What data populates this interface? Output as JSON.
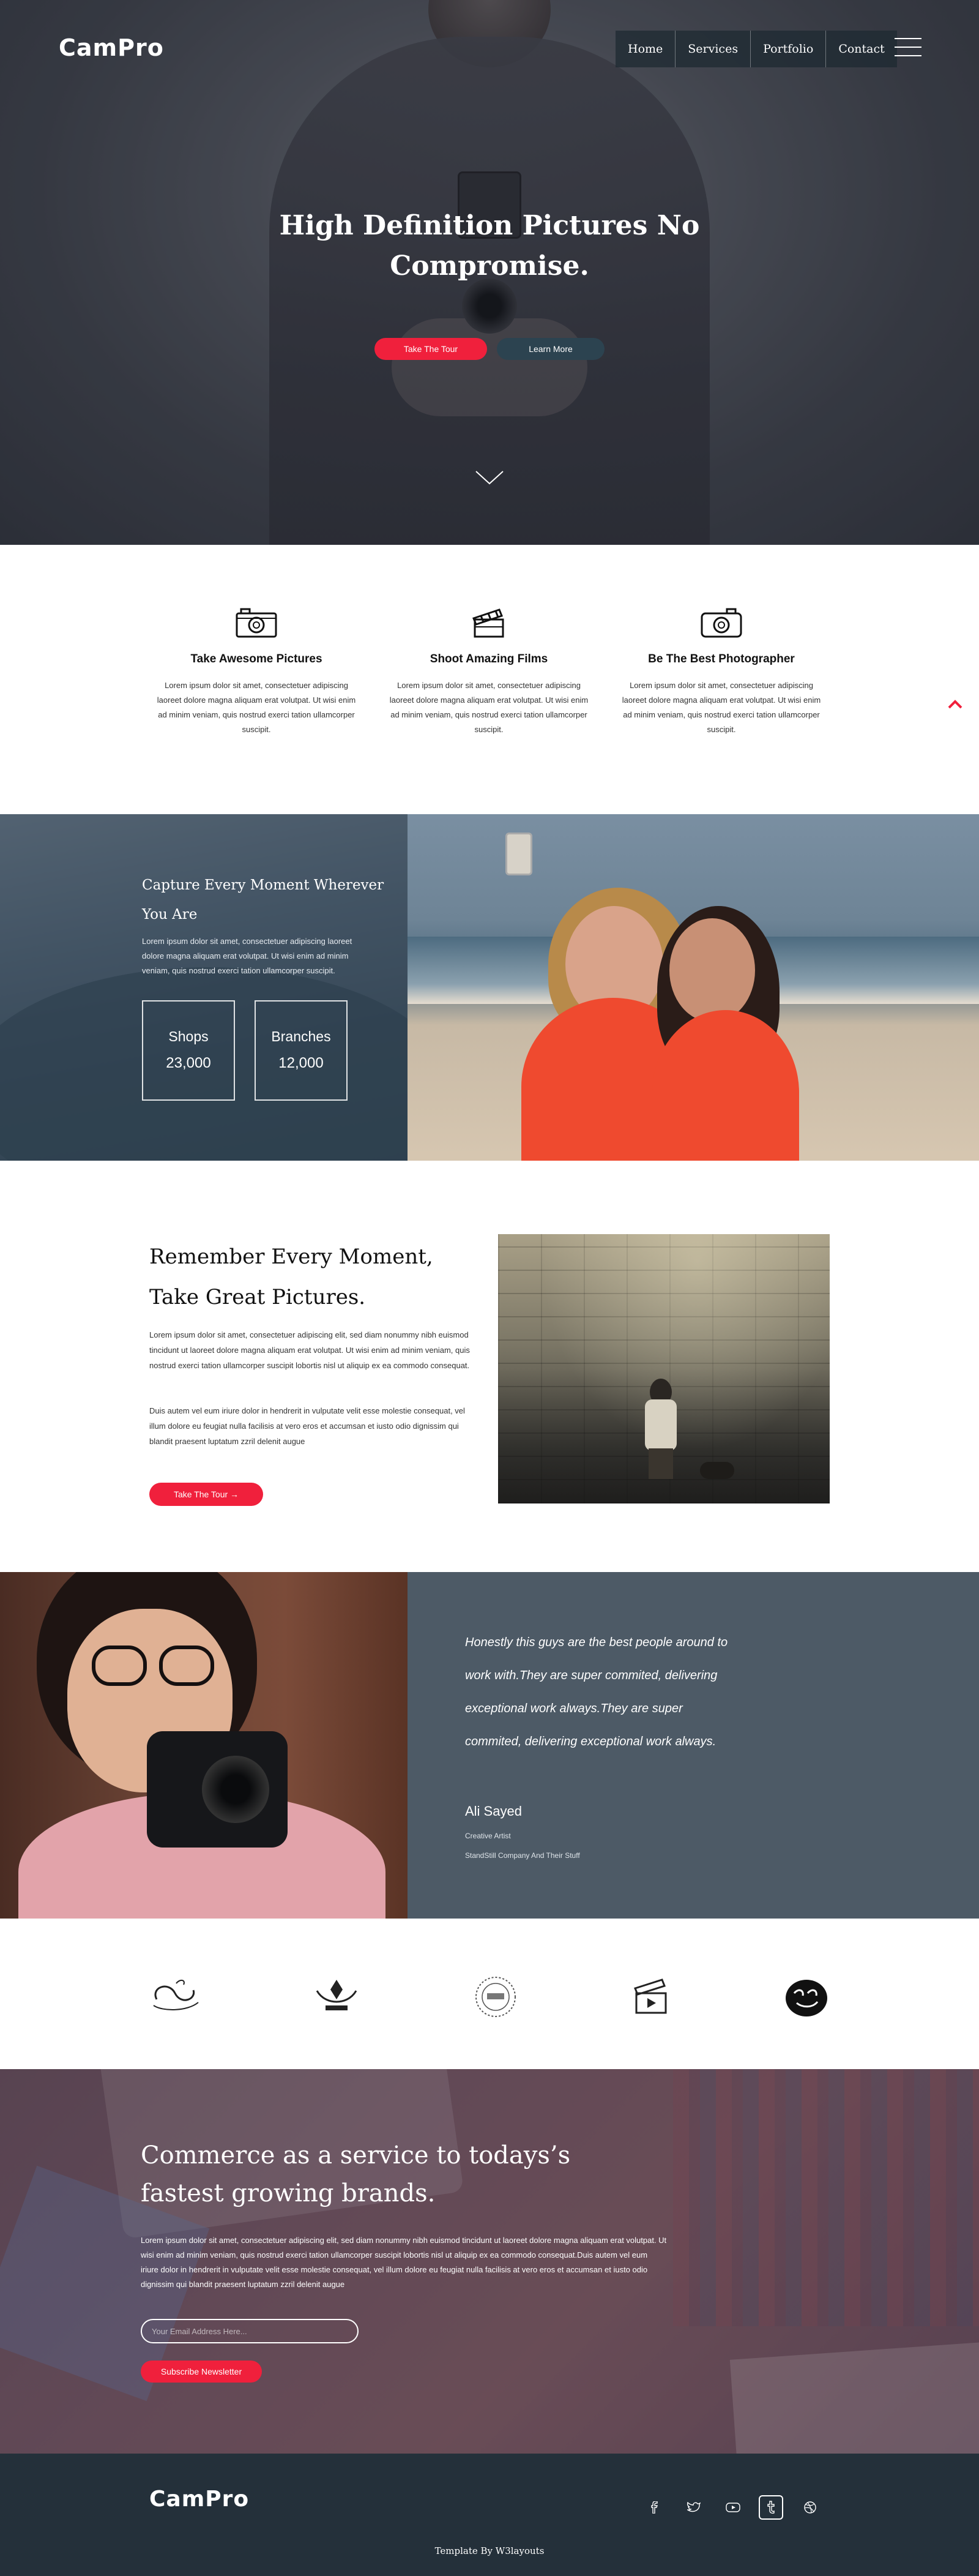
{
  "header": {
    "logo": "CamPro",
    "nav": [
      "Home",
      "Services",
      "Portfolio",
      "Contact"
    ]
  },
  "hero": {
    "title": "High Definition Pictures No Compromise.",
    "primary_button": "Take The Tour",
    "secondary_button": "Learn More"
  },
  "features": [
    {
      "icon": "camera-icon",
      "title": "Take Awesome Pictures",
      "text": "Lorem ipsum dolor sit amet, consectetuer adipiscing laoreet dolore magna aliquam erat volutpat. Ut wisi enim ad minim veniam, quis nostrud exerci tation ullamcorper suscipit."
    },
    {
      "icon": "clapperboard-icon",
      "title": "Shoot Amazing Films",
      "text": "Lorem ipsum dolor sit amet, consectetuer adipiscing laoreet dolore magna aliquam erat volutpat. Ut wisi enim ad minim veniam, quis nostrud exerci tation ullamcorper suscipit."
    },
    {
      "icon": "camera-icon",
      "title": "Be The Best Photographer",
      "text": "Lorem ipsum dolor sit amet, consectetuer adipiscing laoreet dolore magna aliquam erat volutpat. Ut wisi enim ad minim veniam, quis nostrud exerci tation ullamcorper suscipit."
    }
  ],
  "capture": {
    "title": "Capture Every Moment Wherever You Are",
    "text": "Lorem ipsum dolor sit amet, consectetuer adipiscing laoreet dolore magna aliquam erat volutpat. Ut wisi enim ad minim veniam, quis nostrud exerci tation ullamcorper suscipit.",
    "stats": [
      {
        "label": "Shops",
        "value": "23,000"
      },
      {
        "label": "Branches",
        "value": "12,000"
      }
    ]
  },
  "remember": {
    "title": "Remember Every Moment, Take Great Pictures.",
    "paragraph1": "Lorem ipsum dolor sit amet, consectetuer adipiscing elit, sed diam nonummy nibh euismod tincidunt ut laoreet dolore magna aliquam erat volutpat. Ut wisi enim ad minim veniam, quis nostrud exerci tation ullamcorper suscipit lobortis nisl ut aliquip ex ea commodo consequat.",
    "paragraph2": "Duis autem vel eum iriure dolor in hendrerit in vulputate velit esse molestie consequat, vel illum dolore eu feugiat nulla facilisis at vero eros et accumsan et iusto odio dignissim qui blandit praesent luptatum zzril delenit augue",
    "button": "Take The Tour →"
  },
  "testimonial": {
    "quote": "Honestly this guys are the best people around to work with.They are super commited, delivering exceptional work always.They are super commited, delivering exceptional work always.",
    "name": "Ali Sayed",
    "role": "Creative Artist",
    "company": "StandStill Company And Their Stuff"
  },
  "clients": [
    "gym",
    "adolis",
    "corporate",
    "film",
    "love-shirt"
  ],
  "newsletter": {
    "title": "Commerce as a service to todays’s fastest growing brands.",
    "text": "Lorem ipsum dolor sit amet, consectetuer adipiscing elit, sed diam nonummy nibh euismod tincidunt ut laoreet dolore magna aliquam erat volutpat. Ut wisi enim ad minim veniam, quis nostrud exerci tation ullamcorper suscipit lobortis nisl ut aliquip ex ea commodo consequat.Duis autem vel eum iriure dolor in hendrerit in vulputate velit esse molestie consequat, vel illum dolore eu feugiat nulla facilisis at vero eros et accumsan et iusto odio dignissim qui blandit praesent luptatum zzril delenit augue",
    "email_placeholder": "Your Email Address Here...",
    "button": "Subscribe Newsletter"
  },
  "footer": {
    "logo": "CamPro",
    "social": [
      "facebook-icon",
      "twitter-icon",
      "youtube-icon",
      "tumblr-icon",
      "dribbble-icon"
    ],
    "credit": "Template By W3layouts"
  },
  "colors": {
    "accent": "#f0203c",
    "dark_button": "#2c4350",
    "footer": "#24303a",
    "testimonial_bg": "#4d5a66"
  }
}
